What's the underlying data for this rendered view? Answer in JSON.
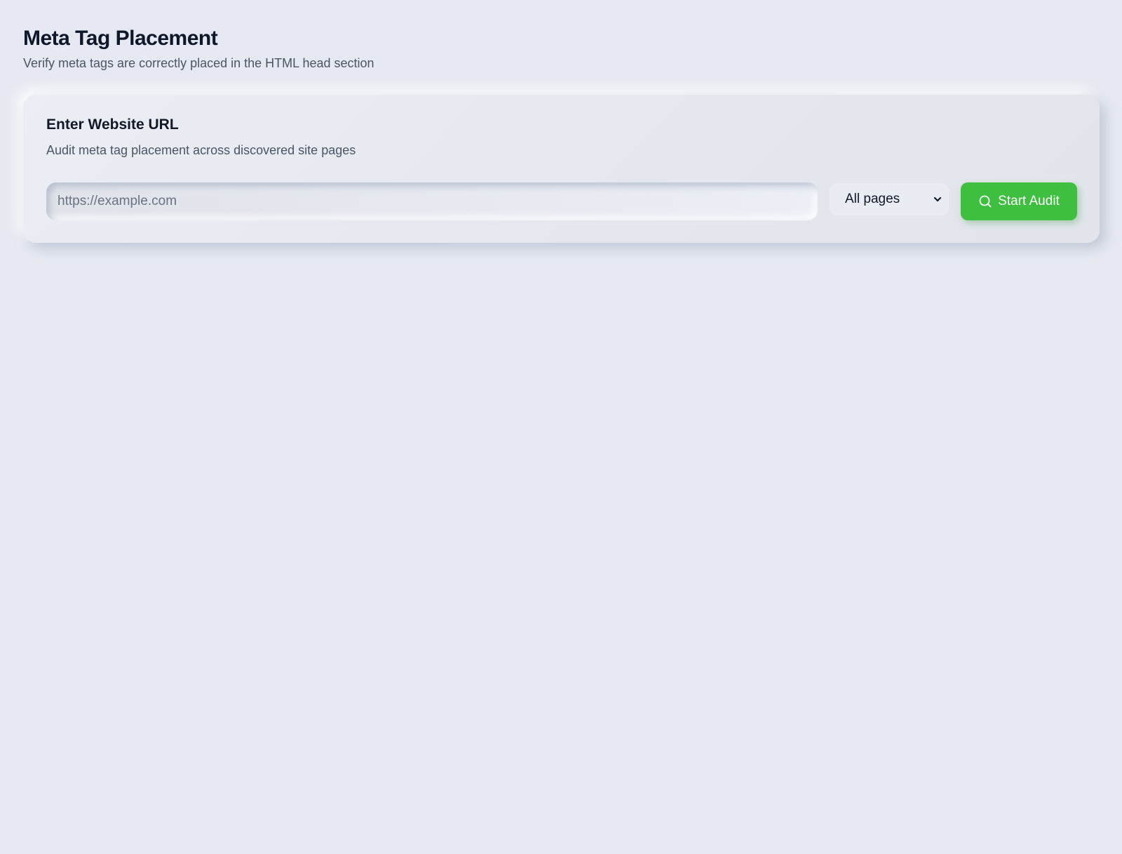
{
  "header": {
    "title": "Meta Tag Placement",
    "subtitle": "Verify meta tags are correctly placed in the HTML head section"
  },
  "card": {
    "title": "Enter Website URL",
    "description": "Audit meta tag placement across discovered site pages",
    "url_input": {
      "value": "",
      "placeholder": "https://example.com"
    },
    "scope_select": {
      "selected": "All pages",
      "icon": "chevron-down-icon"
    },
    "start_button": {
      "label": "Start Audit",
      "icon": "search-icon"
    }
  },
  "colors": {
    "background": "#e6e9f1",
    "accent": "#3ebf3f",
    "title_text": "#0f172a",
    "muted_text": "#4b5563"
  }
}
